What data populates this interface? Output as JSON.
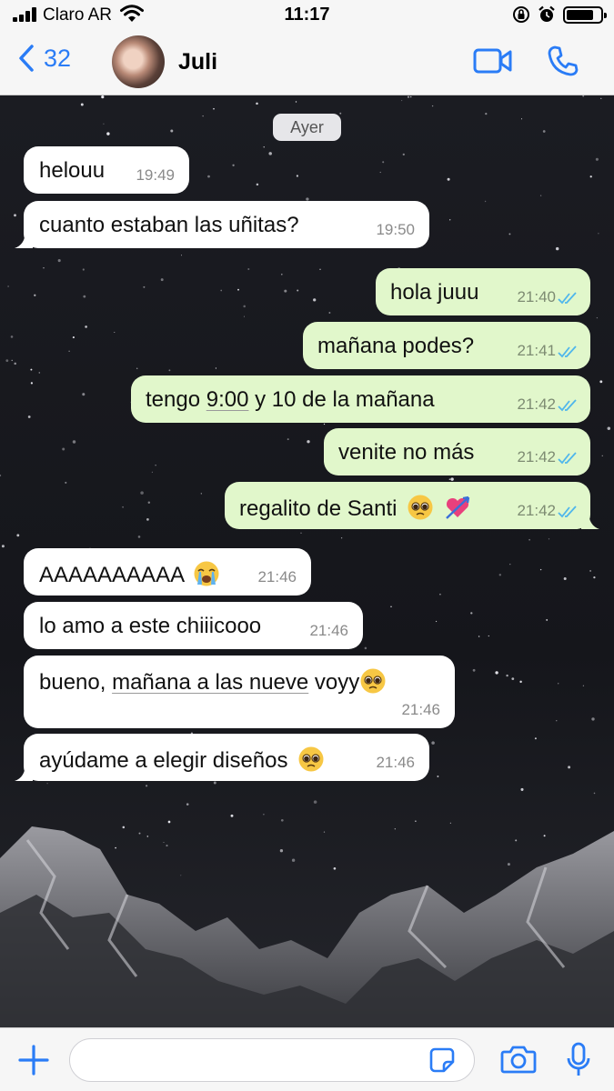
{
  "status_bar": {
    "carrier": "Claro AR",
    "time": "11:17",
    "battery_level": 0.8
  },
  "header": {
    "back_count": "32",
    "contact_name": "Juli",
    "icons": [
      "chevron-left-icon",
      "video-camera-icon",
      "phone-icon"
    ]
  },
  "day_separator": "Ayer",
  "messages": [
    {
      "dir": "in",
      "text": "helouu",
      "time": "19:49"
    },
    {
      "dir": "in",
      "text": "cuanto estaban las uñitas?",
      "time": "19:50"
    },
    {
      "dir": "out",
      "text": "hola juuu",
      "time": "21:40",
      "status": "read"
    },
    {
      "dir": "out",
      "text": "mañana podes?",
      "time": "21:41",
      "status": "read"
    },
    {
      "dir": "out",
      "text_before": "tengo ",
      "text_link": "9:00",
      "text_after": " y 10 de la mañana",
      "time": "21:42",
      "status": "read"
    },
    {
      "dir": "out",
      "text": "venite no más",
      "time": "21:42",
      "status": "read"
    },
    {
      "dir": "out",
      "text": "regalito de Santi",
      "emojis": [
        "pleading-face",
        "heart-with-arrow"
      ],
      "time": "21:42",
      "status": "read"
    },
    {
      "dir": "in",
      "text": "AAAAAAAAAA",
      "emojis": [
        "loudly-crying-face"
      ],
      "time": "21:46"
    },
    {
      "dir": "in",
      "text": "lo amo a este chiiicooo",
      "time": "21:46"
    },
    {
      "dir": "in",
      "text_before": "bueno, ",
      "text_link": "mañana a las nueve",
      "text_after": " voyy",
      "emojis": [
        "pleading-face"
      ],
      "time": "21:46"
    },
    {
      "dir": "in",
      "text": "ayúdame a elegir diseños",
      "emojis": [
        "pleading-face"
      ],
      "time": "21:46"
    }
  ],
  "input_bar": {
    "placeholder": "",
    "icons": [
      "plus-icon",
      "sticker-icon",
      "camera-icon",
      "microphone-icon"
    ]
  },
  "colors": {
    "accent": "#2a7cf6",
    "outgoing_bubble": "#e1f7cb",
    "incoming_bubble": "#ffffff",
    "read_ticks": "#4fb6ec"
  }
}
